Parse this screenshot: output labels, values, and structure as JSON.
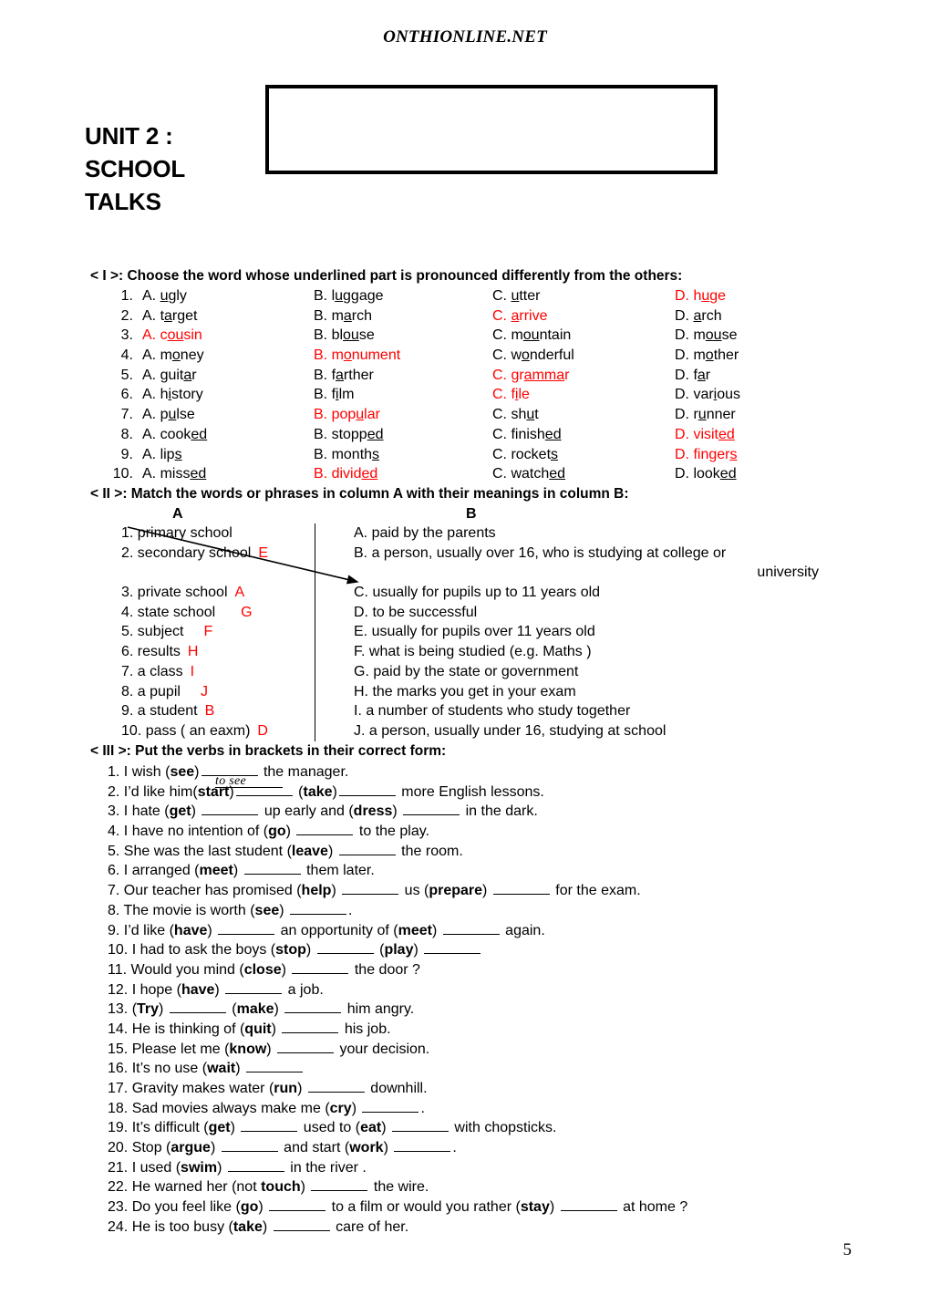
{
  "header": {
    "site": "ONTHIONLINE.NET",
    "unit_title": "UNIT 2 : SCHOOL TALKS",
    "title_box_text": ""
  },
  "footer": {
    "page_number": "5"
  },
  "part1": {
    "heading": "< I >: Choose the word whose underlined part is pronounced differently from the others:",
    "rows": [
      {
        "num": "1.",
        "a": {
          "pre": "A. ",
          "u": "u",
          "post": "gly",
          "red": false
        },
        "b": {
          "pre": "B. l",
          "u": "u",
          "post": "ggage",
          "red": false
        },
        "c": {
          "pre": "C. ",
          "u": "u",
          "post": "tter",
          "red": false
        },
        "d": {
          "pre": "D. h",
          "u": "u",
          "post": "ge",
          "red": true
        }
      },
      {
        "num": "2.",
        "a": {
          "pre": "A. t",
          "u": "a",
          "post": "rget",
          "red": false
        },
        "b": {
          "pre": "B. m",
          "u": "a",
          "post": "rch",
          "red": false
        },
        "c": {
          "pre": "C. ",
          "u": "a",
          "post": "rrive",
          "red": true
        },
        "d": {
          "pre": "D. ",
          "u": "a",
          "post": "rch",
          "red": false
        }
      },
      {
        "num": "3.",
        "a": {
          "pre": "A. c",
          "u": "ou",
          "post": "sin",
          "red": true
        },
        "b": {
          "pre": "B. bl",
          "u": "ou",
          "post": "se",
          "red": false
        },
        "c": {
          "pre": "C. m",
          "u": "ou",
          "post": "ntain",
          "red": false
        },
        "d": {
          "pre": "D. m",
          "u": "ou",
          "post": "se",
          "red": false
        }
      },
      {
        "num": "4.",
        "a": {
          "pre": "A. m",
          "u": "o",
          "post": "ney",
          "red": false
        },
        "b": {
          "pre": "B. m",
          "u": "o",
          "post": "nument",
          "red": true
        },
        "c": {
          "pre": "C. w",
          "u": "o",
          "post": "nderful",
          "red": false
        },
        "d": {
          "pre": "D. m",
          "u": "o",
          "post": "ther",
          "red": false
        }
      },
      {
        "num": "5.",
        "a": {
          "pre": "A. guit",
          "u": "a",
          "post": "r",
          "red": false
        },
        "b": {
          "pre": "B. f",
          "u": "a",
          "post": "rther",
          "red": false
        },
        "c": {
          "pre": "C. gr",
          "u": "amma",
          "post": "r",
          "red": true
        },
        "d": {
          "pre": "D. f",
          "u": "a",
          "post": "r",
          "red": false
        }
      },
      {
        "num": "6.",
        "a": {
          "pre": "A. h",
          "u": "i",
          "post": "story",
          "red": false
        },
        "b": {
          "pre": "B. f",
          "u": "i",
          "post": "lm",
          "red": false
        },
        "c": {
          "pre": "C. f",
          "u": "i",
          "post": "le",
          "red": true
        },
        "d": {
          "pre": "D. var",
          "u": "i",
          "post": "ous",
          "red": false
        }
      },
      {
        "num": "7.",
        "a": {
          "pre": "A. p",
          "u": "u",
          "post": "lse",
          "red": false
        },
        "b": {
          "pre": "B. pop",
          "u": "u",
          "post": "lar",
          "red": true
        },
        "c": {
          "pre": "C. sh",
          "u": "u",
          "post": "t",
          "red": false
        },
        "d": {
          "pre": "D. r",
          "u": "u",
          "post": "nner",
          "red": false
        }
      },
      {
        "num": "8.",
        "a": {
          "pre": "A. cook",
          "u": "ed",
          "post": "",
          "red": false
        },
        "b": {
          "pre": "B. stopp",
          "u": "ed",
          "post": "",
          "red": false
        },
        "c": {
          "pre": "C. finish",
          "u": "ed",
          "post": "",
          "red": false
        },
        "d": {
          "pre": "D. visit",
          "u": "ed",
          "post": "",
          "red": true
        }
      },
      {
        "num": "9.",
        "a": {
          "pre": "A. lip",
          "u": "s",
          "post": "",
          "red": false
        },
        "b": {
          "pre": "B. month",
          "u": "s",
          "post": "",
          "red": false
        },
        "c": {
          "pre": "C. rocket",
          "u": "s",
          "post": "",
          "red": false
        },
        "d": {
          "pre": "D. finger",
          "u": "s",
          "post": "",
          "red": true
        }
      },
      {
        "num": "10.",
        "a": {
          "pre": "A. miss",
          "u": "ed",
          "post": "",
          "red": false
        },
        "b": {
          "pre": "B. divid",
          "u": "ed",
          "post": "",
          "red": true
        },
        "c": {
          "pre": "C. watch",
          "u": "ed",
          "post": "",
          "red": false
        },
        "d": {
          "pre": "D. look",
          "u": "ed",
          "post": "",
          "red": false
        }
      }
    ]
  },
  "part2": {
    "heading": "< II >: Match the words or phrases in column A with their meanings  in column B:",
    "column_a_letter": "A",
    "column_b_letter": "B",
    "left_items": [
      {
        "text": "1. primary school",
        "answer": ""
      },
      {
        "text": "2. secondary school",
        "answer": "E"
      },
      {
        "text": "",
        "answer": ""
      },
      {
        "text": "3. private school",
        "answer": "A"
      },
      {
        "text": "4. state school",
        "answer": "G"
      },
      {
        "text": "5. subject",
        "answer": "F"
      },
      {
        "text": "6. results",
        "answer": "H"
      },
      {
        "text": "7. a class",
        "answer": "I"
      },
      {
        "text": "8. a pupil",
        "answer": "J"
      },
      {
        "text": "9. a student",
        "answer": "B"
      },
      {
        "text": "10. pass ( an eaxm)",
        "answer": "D"
      }
    ],
    "right_items": [
      {
        "line1": "A. paid by the parents",
        "line2": ""
      },
      {
        "line1": "B. a person, usually over 16, who is studying at college or",
        "line2": "university"
      },
      {
        "line1": "C. usually for pupils up to 11 years old",
        "line2": ""
      },
      {
        "line1": "D. to be successful",
        "line2": ""
      },
      {
        "line1": "E. usually for pupils over 11 years old",
        "line2": ""
      },
      {
        "line1": "F. what is being studied (e.g. Maths )",
        "line2": ""
      },
      {
        "line1": "G. paid by the state or government",
        "line2": ""
      },
      {
        "line1": "H. the marks you get in your exam",
        "line2": ""
      },
      {
        "line1": "I. a number of students who study together",
        "line2": ""
      },
      {
        "line1": "J. a person, usually under 16, studying at school",
        "line2": ""
      }
    ]
  },
  "part3": {
    "heading": "< III >: Put the verbs in brackets in their correct form:",
    "handwritten_answer": "to see",
    "rows": [
      {
        "num": "1. ",
        "segments": [
          {
            "t": "I wish ("
          },
          {
            "t": "see",
            "b": true
          },
          {
            "t": ")"
          },
          {
            "blank": true
          },
          {
            "t": " the manager."
          }
        ]
      },
      {
        "num": "2. ",
        "segments": [
          {
            "t": "I’d like him("
          },
          {
            "t": "start",
            "b": true
          },
          {
            "t": ")"
          },
          {
            "blank": true
          },
          {
            "t": " ("
          },
          {
            "t": "take",
            "b": true
          },
          {
            "t": ")"
          },
          {
            "blank": true
          },
          {
            "t": " more English lessons."
          }
        ]
      },
      {
        "num": "3. ",
        "segments": [
          {
            "t": "I hate ("
          },
          {
            "t": "get",
            "b": true
          },
          {
            "t": ") "
          },
          {
            "blank": true
          },
          {
            "t": " up early and ("
          },
          {
            "t": "dress",
            "b": true
          },
          {
            "t": ") "
          },
          {
            "blank": true
          },
          {
            "t": " in the dark."
          }
        ]
      },
      {
        "num": "4. ",
        "segments": [
          {
            "t": "I have no intention of ("
          },
          {
            "t": "go",
            "b": true
          },
          {
            "t": ") "
          },
          {
            "blank": true
          },
          {
            "t": " to the play."
          }
        ]
      },
      {
        "num": "5. ",
        "segments": [
          {
            "t": "She was the last student ("
          },
          {
            "t": "leave",
            "b": true
          },
          {
            "t": ") "
          },
          {
            "blank": true
          },
          {
            "t": " the room."
          }
        ]
      },
      {
        "num": "6. ",
        "segments": [
          {
            "t": "I arranged ("
          },
          {
            "t": "meet",
            "b": true
          },
          {
            "t": ") "
          },
          {
            "blank": true
          },
          {
            "t": " them later."
          }
        ]
      },
      {
        "num": "7. ",
        "segments": [
          {
            "t": "Our teacher has promised ("
          },
          {
            "t": "help",
            "b": true
          },
          {
            "t": ") "
          },
          {
            "blank": true
          },
          {
            "t": " us ("
          },
          {
            "t": "prepare",
            "b": true
          },
          {
            "t": ") "
          },
          {
            "blank": true
          },
          {
            "t": " for the exam."
          }
        ]
      },
      {
        "num": "8. ",
        "segments": [
          {
            "t": "The movie is worth ("
          },
          {
            "t": "see",
            "b": true
          },
          {
            "t": ") "
          },
          {
            "blank": true
          },
          {
            "t": "."
          }
        ]
      },
      {
        "num": "9. ",
        "segments": [
          {
            "t": "I’d like ("
          },
          {
            "t": "have",
            "b": true
          },
          {
            "t": ") "
          },
          {
            "blank": true
          },
          {
            "t": " an opportunity of ("
          },
          {
            "t": "meet",
            "b": true
          },
          {
            "t": ") "
          },
          {
            "blank": true
          },
          {
            "t": " again."
          }
        ]
      },
      {
        "num": "10. ",
        "segments": [
          {
            "t": "I had to ask the boys ("
          },
          {
            "t": "stop",
            "b": true
          },
          {
            "t": ") "
          },
          {
            "blank": true
          },
          {
            "t": " ("
          },
          {
            "t": "play",
            "b": true
          },
          {
            "t": ") "
          },
          {
            "blank": true
          }
        ]
      },
      {
        "num": "11. ",
        "segments": [
          {
            "t": "Would you mind ("
          },
          {
            "t": "close",
            "b": true
          },
          {
            "t": ") "
          },
          {
            "blank": true
          },
          {
            "t": " the door ?"
          }
        ]
      },
      {
        "num": "12. ",
        "segments": [
          {
            "t": "I hope ("
          },
          {
            "t": "have",
            "b": true
          },
          {
            "t": ") "
          },
          {
            "blank": true
          },
          {
            "t": " a job."
          }
        ]
      },
      {
        "num": "13. ",
        "segments": [
          {
            "t": "("
          },
          {
            "t": "Try",
            "b": true
          },
          {
            "t": ") "
          },
          {
            "blank": true
          },
          {
            "t": " ("
          },
          {
            "t": "make",
            "b": true
          },
          {
            "t": ") "
          },
          {
            "blank": true
          },
          {
            "t": " him angry."
          }
        ]
      },
      {
        "num": "14. ",
        "segments": [
          {
            "t": "He is thinking of ("
          },
          {
            "t": "quit",
            "b": true
          },
          {
            "t": ") "
          },
          {
            "blank": true
          },
          {
            "t": " his job."
          }
        ]
      },
      {
        "num": "15. ",
        "segments": [
          {
            "t": "Please let me ("
          },
          {
            "t": "know",
            "b": true
          },
          {
            "t": ") "
          },
          {
            "blank": true
          },
          {
            "t": " your decision."
          }
        ]
      },
      {
        "num": "16. ",
        "segments": [
          {
            "t": "It’s no use ("
          },
          {
            "t": "wait",
            "b": true
          },
          {
            "t": ") "
          },
          {
            "blank": true
          }
        ]
      },
      {
        "num": "17. ",
        "segments": [
          {
            "t": "Gravity makes water ("
          },
          {
            "t": "run",
            "b": true
          },
          {
            "t": ") "
          },
          {
            "blank": true
          },
          {
            "t": " downhill."
          }
        ]
      },
      {
        "num": "18. ",
        "segments": [
          {
            "t": "Sad movies always make me ("
          },
          {
            "t": "cry",
            "b": true
          },
          {
            "t": ") "
          },
          {
            "blank": true
          },
          {
            "t": "."
          }
        ]
      },
      {
        "num": "19. ",
        "segments": [
          {
            "t": "It’s difficult ("
          },
          {
            "t": "get",
            "b": true
          },
          {
            "t": ") "
          },
          {
            "blank": true
          },
          {
            "t": " used to ("
          },
          {
            "t": "eat",
            "b": true
          },
          {
            "t": ") "
          },
          {
            "blank": true
          },
          {
            "t": " with chopsticks."
          }
        ]
      },
      {
        "num": "20. ",
        "segments": [
          {
            "t": "Stop ("
          },
          {
            "t": "argue",
            "b": true
          },
          {
            "t": ") "
          },
          {
            "blank": true
          },
          {
            "t": " and start ("
          },
          {
            "t": "work",
            "b": true
          },
          {
            "t": ") "
          },
          {
            "blank": true
          },
          {
            "t": "."
          }
        ]
      },
      {
        "num": "21. ",
        "segments": [
          {
            "t": "I used ("
          },
          {
            "t": "swim",
            "b": true
          },
          {
            "t": ") "
          },
          {
            "blank": true
          },
          {
            "t": " in the river ."
          }
        ]
      },
      {
        "num": "22. ",
        "segments": [
          {
            "t": "He warned her (not "
          },
          {
            "t": "touch",
            "b": true
          },
          {
            "t": ") "
          },
          {
            "blank": true
          },
          {
            "t": " the wire."
          }
        ]
      },
      {
        "num": "23. ",
        "segments": [
          {
            "t": "Do you feel like ("
          },
          {
            "t": "go",
            "b": true
          },
          {
            "t": ") "
          },
          {
            "blank": true
          },
          {
            "t": " to a film or would you rather ("
          },
          {
            "t": "stay",
            "b": true
          },
          {
            "t": ") "
          },
          {
            "blank": true
          },
          {
            "t": " at home ?"
          }
        ]
      },
      {
        "num": "24. ",
        "segments": [
          {
            "t": "He is too busy ("
          },
          {
            "t": "take",
            "b": true
          },
          {
            "t": ") "
          },
          {
            "blank": true
          },
          {
            "t": " care of her."
          }
        ]
      }
    ]
  }
}
